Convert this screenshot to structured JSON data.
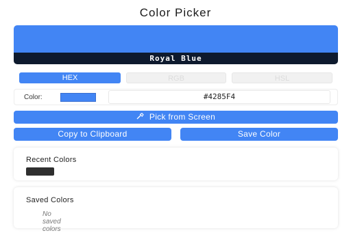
{
  "app": {
    "title": "Color Picker"
  },
  "preview": {
    "color": "#4285F4",
    "name": "Royal Blue"
  },
  "tabs": [
    {
      "label": "HEX",
      "active": true
    },
    {
      "label": "RGB",
      "active": false
    },
    {
      "label": "HSL",
      "active": false
    }
  ],
  "color_row": {
    "label": "Color:",
    "swatch_color": "#4285F4",
    "value": "#4285F4"
  },
  "buttons": {
    "pick_from_screen": "Pick from Screen",
    "pick_icon": "eyedropper-icon",
    "copy": "Copy to Clipboard",
    "save": "Save Color"
  },
  "recent": {
    "title": "Recent Colors",
    "swatches": [
      "#2f2f2f"
    ]
  },
  "saved": {
    "title": "Saved Colors",
    "empty_text": "No saved colors"
  },
  "colors": {
    "accent": "#4285f4",
    "name_bar": "#0e1a2e"
  }
}
